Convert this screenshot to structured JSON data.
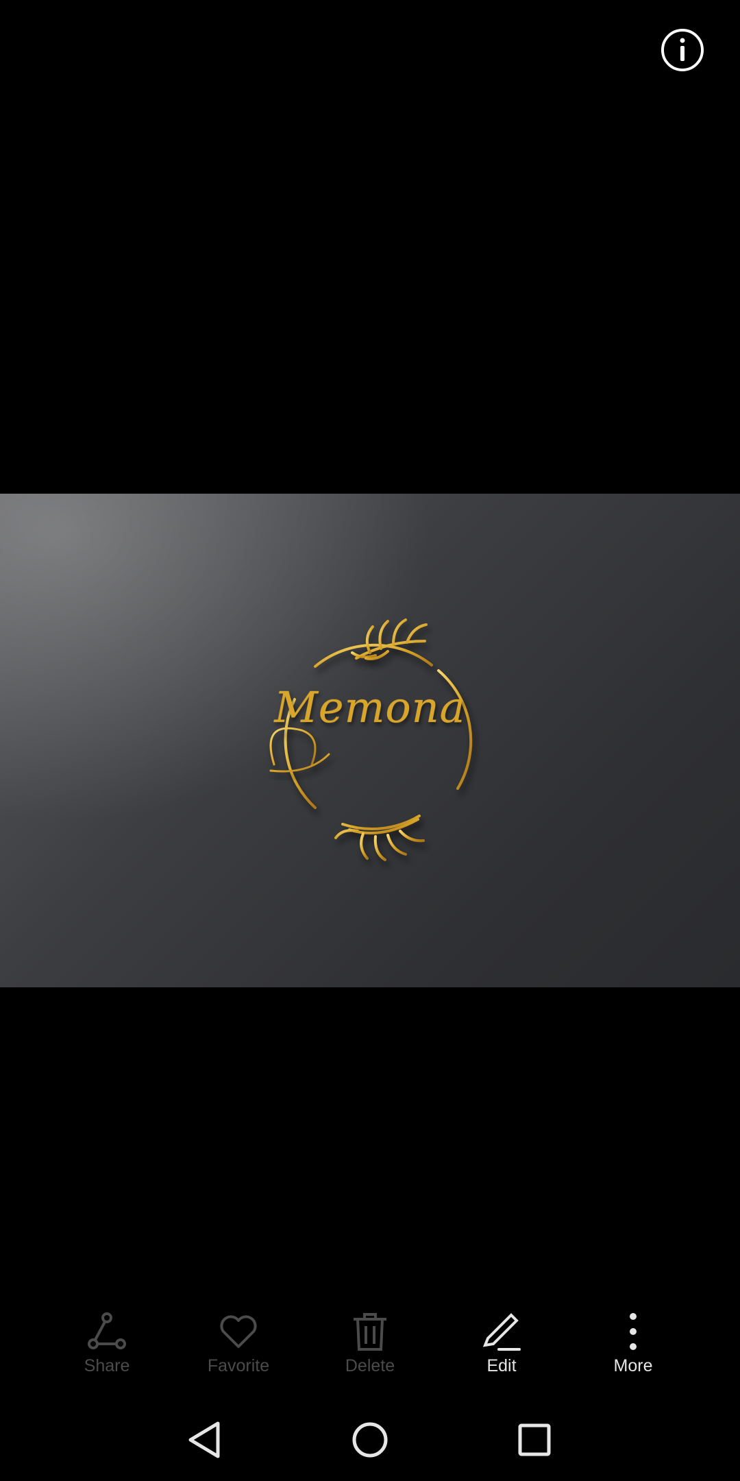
{
  "photo": {
    "logo_text": "Memona",
    "accent_color": "#d9a62a"
  },
  "top_bar": {
    "info_icon": "info-icon"
  },
  "actions": [
    {
      "label": "Share",
      "icon": "share-icon",
      "enabled": false
    },
    {
      "label": "Favorite",
      "icon": "heart-icon",
      "enabled": false
    },
    {
      "label": "Delete",
      "icon": "trash-icon",
      "enabled": false
    },
    {
      "label": "Edit",
      "icon": "pencil-icon",
      "enabled": true
    },
    {
      "label": "More",
      "icon": "more-vertical-icon",
      "enabled": true
    }
  ],
  "nav": {
    "back_icon": "back-triangle-icon",
    "home_icon": "home-circle-icon",
    "recents_icon": "recents-square-icon"
  }
}
